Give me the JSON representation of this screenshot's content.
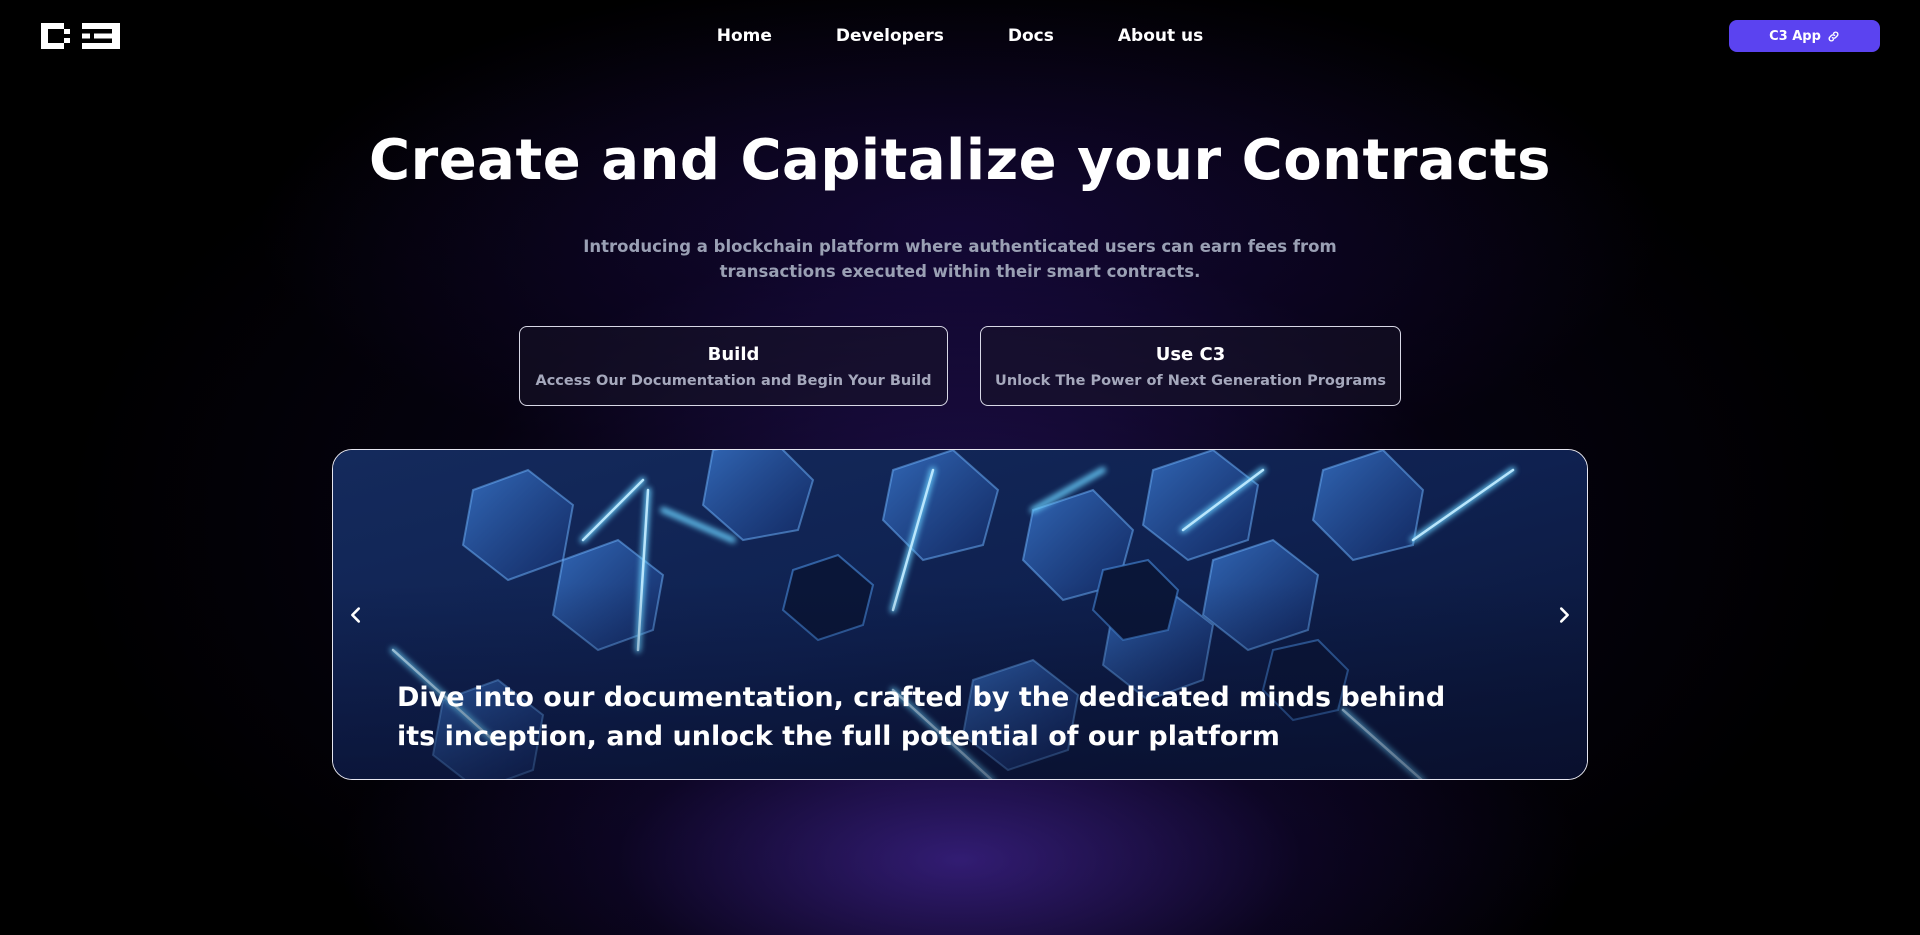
{
  "nav": {
    "logo_icon": "c3-logo",
    "links": [
      {
        "label": "Home"
      },
      {
        "label": "Developers"
      },
      {
        "label": "Docs"
      },
      {
        "label": "About us"
      }
    ],
    "app_button": {
      "label": "C3 App",
      "icon": "external-link-icon"
    }
  },
  "hero": {
    "title": "Create and Capitalize your Contracts",
    "subtitle": "Introducing a blockchain platform where authenticated users can earn fees from transactions executed within their smart contracts."
  },
  "cta": {
    "build": {
      "title": "Build",
      "description": "Access Our Documentation and Begin Your Build"
    },
    "use": {
      "title": "Use C3",
      "description": "Unlock The Power of Next Generation Programs"
    }
  },
  "carousel": {
    "caption": "Dive into our documentation, crafted by the dedicated minds behind its inception, and unlock the full potential of our platform",
    "prev_icon": "chevron-left-icon",
    "next_icon": "chevron-right-icon"
  },
  "colors": {
    "accent": "#5b43f0",
    "background": "#000000",
    "muted_text": "#9aa0b4"
  }
}
